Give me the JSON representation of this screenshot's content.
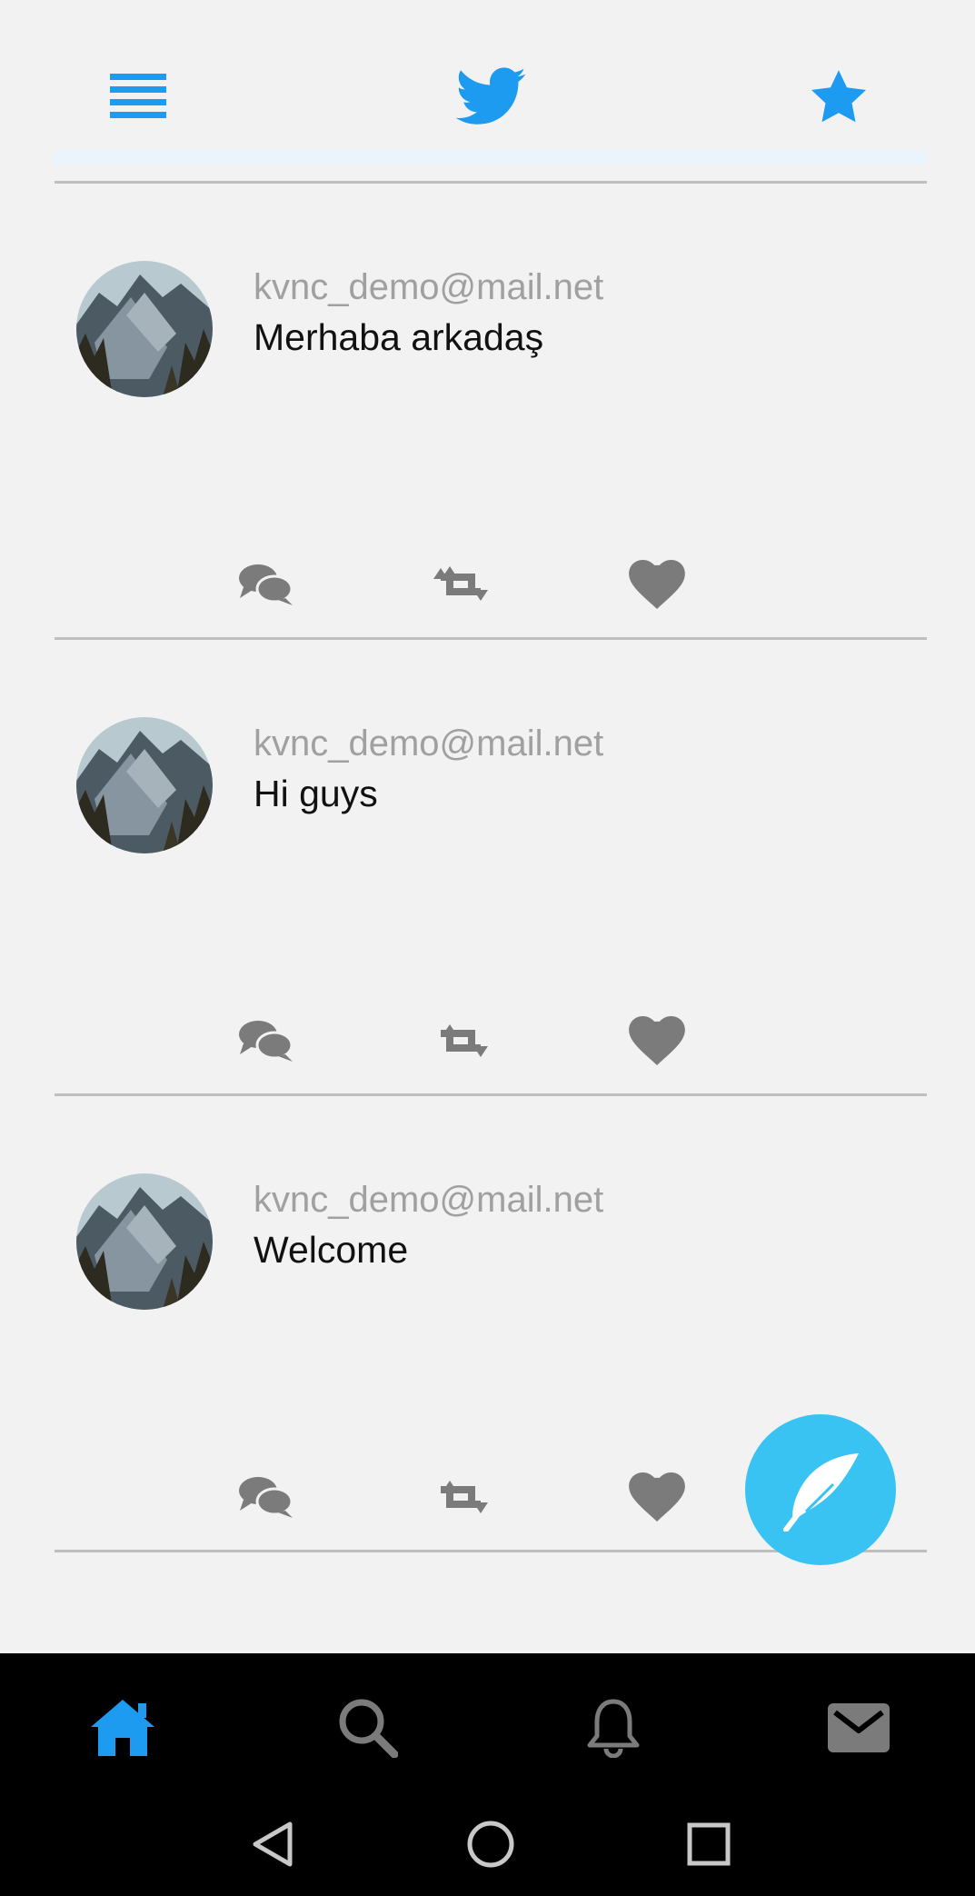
{
  "colors": {
    "background": "#f2f2f2",
    "accent": "#1d9bf0",
    "icon_gray": "#7b7b7b",
    "fab": "#38c3f2",
    "nav_bar": "#000000"
  },
  "header": {
    "menu_icon": "hamburger-menu-icon",
    "logo_icon": "twitter-bird-icon",
    "star_icon": "star-icon"
  },
  "tweets": [
    {
      "email": "kvnc_demo@mail.net",
      "text": "Merhaba arkadaş"
    },
    {
      "email": "kvnc_demo@mail.net",
      "text": "Hi guys"
    },
    {
      "email": "kvnc_demo@mail.net",
      "text": "Welcome"
    }
  ],
  "tweet_actions": [
    "comment-icon",
    "retweet-icon",
    "heart-icon"
  ],
  "fab": {
    "icon": "feather-icon"
  },
  "bottom_nav": {
    "items": [
      "home-icon",
      "search-icon",
      "bell-icon",
      "mail-icon"
    ],
    "active": "home-icon"
  },
  "system_nav": [
    "back-icon",
    "home-circle-icon",
    "recents-icon"
  ]
}
